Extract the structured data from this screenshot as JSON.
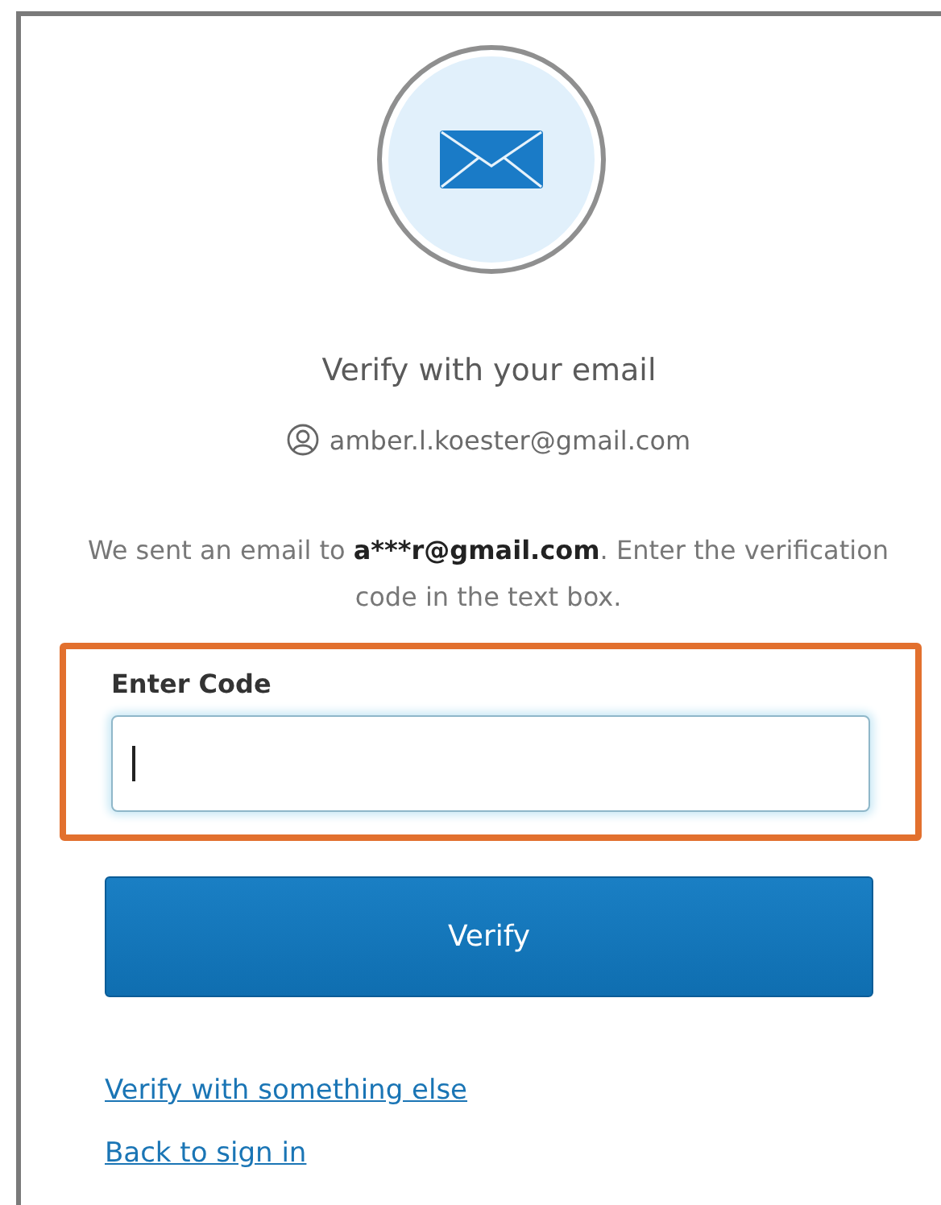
{
  "header": {
    "title": "Verify with your email",
    "username": "amber.l.koester@gmail.com"
  },
  "message": {
    "before": "We sent an email to ",
    "email": "a***r@gmail.com",
    "after": ". Enter the verification code in the text box."
  },
  "code_field": {
    "label": "Enter Code",
    "focused": true,
    "highlighted": true
  },
  "verify_button": {
    "label": "Verify"
  },
  "links": [
    {
      "label": "Verify with something else"
    },
    {
      "label": "Back to sign in"
    }
  ]
}
